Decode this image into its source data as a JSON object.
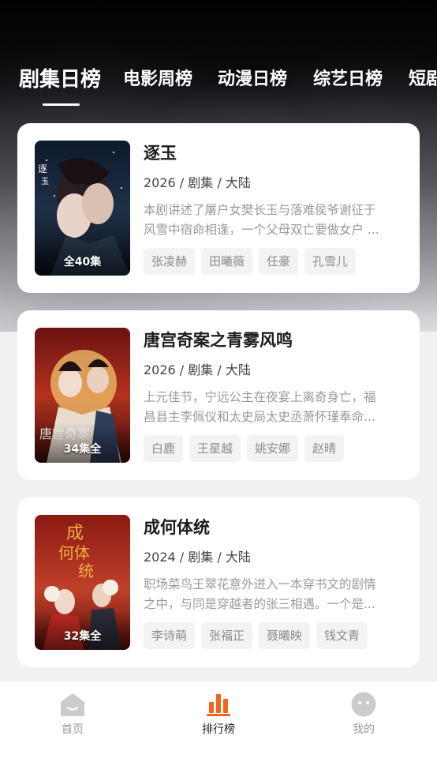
{
  "tabs": [
    {
      "label": "剧集日榜",
      "active": true
    },
    {
      "label": "电影周榜",
      "active": false
    },
    {
      "label": "动漫日榜",
      "active": false
    },
    {
      "label": "综艺日榜",
      "active": false
    },
    {
      "label": "短剧",
      "active": false
    }
  ],
  "cards": [
    {
      "title": "逐玉",
      "meta": "2026 / 剧集 / 大陆",
      "desc_line1": "本剧讲述了屠户女樊长玉与落难侯爷谢征于",
      "desc_line2": "风雪中宿命相逢，一个父母双亡要做女户 ...",
      "badge": "全40集",
      "tags": [
        "张凌赫",
        "田曦薇",
        "任豪",
        "孔雪儿"
      ]
    },
    {
      "title": "唐宫奇案之青雾风鸣",
      "meta": "2026 / 剧集 / 大陆",
      "desc_line1": "上元佳节，宁远公主在夜宴上离奇身亡，福",
      "desc_line2": "昌县主李佩仪和太史局太史丞萧怀瑾奉命...",
      "badge": "34集全",
      "tags": [
        "白鹿",
        "王星越",
        "姚安娜",
        "赵晴"
      ]
    },
    {
      "title": "成何体统",
      "meta": "2024 / 剧集 / 大陆",
      "desc_line1": "职场菜鸟王翠花意外进入一本穿书文的剧情",
      "desc_line2": "之中，与同是穿越者的张三相遇。一个是...",
      "badge": "32集全",
      "tags": [
        "李诗萌",
        "张福正",
        "聂曦映",
        "钱文青"
      ]
    }
  ],
  "nav": {
    "home": "首页",
    "rank": "排行榜",
    "mine": "我的"
  },
  "colors": {
    "accent": "#f2641c",
    "nav_inactive": "#c9c9c9"
  }
}
